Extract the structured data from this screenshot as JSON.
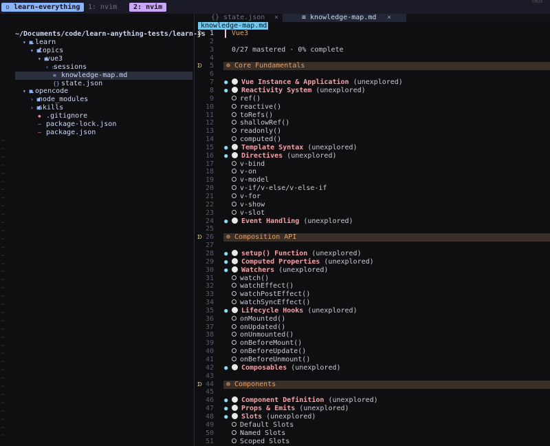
{
  "tmux": {
    "session": "learn-everything",
    "win1": "1: nvim",
    "win2": "2: nvim",
    "top_right": "tmux"
  },
  "explorer": {
    "root": "~/Documents/code/learn-anything-tests/learn-js",
    "items": [
      {
        "icon": "▾ ■",
        "label": ".learn",
        "color": "#cdd6f4",
        "indent": 1
      },
      {
        "icon": "▾ ■",
        "label": "topics",
        "color": "#cdd6f4",
        "indent": 2
      },
      {
        "icon": "▾ ■",
        "label": "vue3",
        "color": "#cdd6f4",
        "indent": 3
      },
      {
        "icon": "› ▫",
        "label": "sessions",
        "color": "#cdd6f4",
        "indent": 4
      },
      {
        "icon": "≡",
        "label": "knowledge-map.md",
        "color": "#cdd6f4",
        "indent": 5,
        "selected": true
      },
      {
        "icon": "{}",
        "label": "state.json",
        "color": "#cdd6f4",
        "indent": 5
      },
      {
        "icon": "▾ ■",
        "label": ".opencode",
        "color": "#cdd6f4",
        "indent": 1
      },
      {
        "icon": "› ■",
        "label": "node_modules",
        "color": "#cdd6f4",
        "indent": 2
      },
      {
        "icon": "› ■",
        "label": "skills",
        "color": "#cdd6f4",
        "indent": 2
      },
      {
        "icon": "◆",
        "label": ".gitignore",
        "color": "#cdd6f4",
        "indent": 3,
        "icon_color": "#f38ba8"
      },
      {
        "icon": "—",
        "label": "package-lock.json",
        "color": "#cdd6f4",
        "indent": 3
      },
      {
        "icon": "—",
        "label": "package.json",
        "color": "#cdd6f4",
        "indent": 3,
        "icon_color": "#f38ba8"
      }
    ],
    "tilde": "~"
  },
  "tabs": {
    "state": "{} state.json",
    "state_close": "×",
    "km": "≡ knowledge-map.md",
    "km_close": "×",
    "winbar": "knowledge-map.md"
  },
  "lines": [
    {
      "n": "1",
      "fold": "ᗤ",
      "cur": true,
      "parts": [
        {
          "t": "Vue3",
          "c": "sect"
        }
      ],
      "hl": false
    },
    {
      "n": "2",
      "parts": []
    },
    {
      "n": "3",
      "parts": [
        {
          "t": "0/27 mastered · 0% complete",
          "c": "dim"
        }
      ]
    },
    {
      "n": "4",
      "parts": []
    },
    {
      "n": "5",
      "fold": "ᗤ",
      "hl": true,
      "parts": [
        {
          "t": "⊕ Core Fundamentals",
          "c": "sect"
        }
      ]
    },
    {
      "n": "6",
      "parts": []
    },
    {
      "n": "7",
      "dot": true,
      "circle": true,
      "parts": [
        {
          "t": "Vue Instance & Application",
          "c": "topic"
        },
        {
          "t": " (unexplored)",
          "c": "dim"
        }
      ]
    },
    {
      "n": "8",
      "dot": true,
      "circle": true,
      "parts": [
        {
          "t": "Reactivity System",
          "c": "topic"
        },
        {
          "t": " (unexplored)",
          "c": "dim"
        }
      ]
    },
    {
      "n": "9",
      "hollow": true,
      "parts": [
        {
          "t": "ref()",
          "c": "dim"
        }
      ]
    },
    {
      "n": "10",
      "hollow": true,
      "parts": [
        {
          "t": "reactive()",
          "c": "dim"
        }
      ]
    },
    {
      "n": "11",
      "hollow": true,
      "parts": [
        {
          "t": "toRefs()",
          "c": "dim"
        }
      ]
    },
    {
      "n": "12",
      "hollow": true,
      "parts": [
        {
          "t": "shallowRef()",
          "c": "dim"
        }
      ]
    },
    {
      "n": "13",
      "hollow": true,
      "parts": [
        {
          "t": "readonly()",
          "c": "dim"
        }
      ]
    },
    {
      "n": "14",
      "hollow": true,
      "parts": [
        {
          "t": "computed()",
          "c": "dim"
        }
      ]
    },
    {
      "n": "15",
      "dot": true,
      "circle": true,
      "parts": [
        {
          "t": "Template Syntax",
          "c": "topic"
        },
        {
          "t": " (unexplored)",
          "c": "dim"
        }
      ]
    },
    {
      "n": "16",
      "dot": true,
      "circle": true,
      "parts": [
        {
          "t": "Directives",
          "c": "topic"
        },
        {
          "t": " (unexplored)",
          "c": "dim"
        }
      ]
    },
    {
      "n": "17",
      "hollow": true,
      "parts": [
        {
          "t": "v-bind",
          "c": "dim"
        }
      ]
    },
    {
      "n": "18",
      "hollow": true,
      "parts": [
        {
          "t": "v-on",
          "c": "dim"
        }
      ]
    },
    {
      "n": "19",
      "hollow": true,
      "parts": [
        {
          "t": "v-model",
          "c": "dim"
        }
      ]
    },
    {
      "n": "20",
      "hollow": true,
      "parts": [
        {
          "t": "v-if/v-else/v-else-if",
          "c": "dim"
        }
      ]
    },
    {
      "n": "21",
      "hollow": true,
      "parts": [
        {
          "t": "v-for",
          "c": "dim"
        }
      ]
    },
    {
      "n": "22",
      "hollow": true,
      "parts": [
        {
          "t": "v-show",
          "c": "dim"
        }
      ]
    },
    {
      "n": "23",
      "hollow": true,
      "parts": [
        {
          "t": "v-slot",
          "c": "dim"
        }
      ]
    },
    {
      "n": "24",
      "dot": true,
      "circle": true,
      "parts": [
        {
          "t": "Event Handling",
          "c": "topic"
        },
        {
          "t": " (unexplored)",
          "c": "dim"
        }
      ]
    },
    {
      "n": "25",
      "parts": []
    },
    {
      "n": "26",
      "fold": "ᗤ",
      "hl": true,
      "parts": [
        {
          "t": "⊕ Composition API",
          "c": "sect"
        }
      ]
    },
    {
      "n": "27",
      "parts": []
    },
    {
      "n": "28",
      "dot": true,
      "circle": true,
      "parts": [
        {
          "t": "setup() Function",
          "c": "topic"
        },
        {
          "t": " (unexplored)",
          "c": "dim"
        }
      ]
    },
    {
      "n": "29",
      "dot": true,
      "circle": true,
      "parts": [
        {
          "t": "Computed Properties",
          "c": "topic"
        },
        {
          "t": " (unexplored)",
          "c": "dim"
        }
      ]
    },
    {
      "n": "30",
      "dot": true,
      "circle": true,
      "parts": [
        {
          "t": "Watchers",
          "c": "topic"
        },
        {
          "t": " (unexplored)",
          "c": "dim"
        }
      ]
    },
    {
      "n": "31",
      "hollow": true,
      "parts": [
        {
          "t": "watch()",
          "c": "dim"
        }
      ]
    },
    {
      "n": "32",
      "hollow": true,
      "parts": [
        {
          "t": "watchEffect()",
          "c": "dim"
        }
      ]
    },
    {
      "n": "33",
      "hollow": true,
      "parts": [
        {
          "t": "watchPostEffect()",
          "c": "dim"
        }
      ]
    },
    {
      "n": "34",
      "hollow": true,
      "parts": [
        {
          "t": "watchSyncEffect()",
          "c": "dim"
        }
      ]
    },
    {
      "n": "35",
      "dot": true,
      "circle": true,
      "parts": [
        {
          "t": "Lifecycle Hooks",
          "c": "topic"
        },
        {
          "t": " (unexplored)",
          "c": "dim"
        }
      ]
    },
    {
      "n": "36",
      "hollow": true,
      "parts": [
        {
          "t": "onMounted()",
          "c": "dim"
        }
      ]
    },
    {
      "n": "37",
      "hollow": true,
      "parts": [
        {
          "t": "onUpdated()",
          "c": "dim"
        }
      ]
    },
    {
      "n": "38",
      "hollow": true,
      "parts": [
        {
          "t": "onUnmounted()",
          "c": "dim"
        }
      ]
    },
    {
      "n": "39",
      "hollow": true,
      "parts": [
        {
          "t": "onBeforeMount()",
          "c": "dim"
        }
      ]
    },
    {
      "n": "40",
      "hollow": true,
      "parts": [
        {
          "t": "onBeforeUpdate()",
          "c": "dim"
        }
      ]
    },
    {
      "n": "41",
      "hollow": true,
      "parts": [
        {
          "t": "onBeforeUnmount()",
          "c": "dim"
        }
      ]
    },
    {
      "n": "42",
      "dot": true,
      "circle": true,
      "parts": [
        {
          "t": "Composables",
          "c": "topic"
        },
        {
          "t": " (unexplored)",
          "c": "dim"
        }
      ]
    },
    {
      "n": "43",
      "parts": []
    },
    {
      "n": "44",
      "fold": "ᗤ",
      "hl": true,
      "parts": [
        {
          "t": "⊕ Components",
          "c": "sect"
        }
      ]
    },
    {
      "n": "45",
      "parts": []
    },
    {
      "n": "46",
      "dot": true,
      "circle": true,
      "parts": [
        {
          "t": "Component Definition",
          "c": "topic"
        },
        {
          "t": " (unexplored)",
          "c": "dim"
        }
      ]
    },
    {
      "n": "47",
      "dot": true,
      "circle": true,
      "parts": [
        {
          "t": "Props & Emits",
          "c": "topic"
        },
        {
          "t": " (unexplored)",
          "c": "dim"
        }
      ]
    },
    {
      "n": "48",
      "dot": true,
      "circle": true,
      "parts": [
        {
          "t": "Slots",
          "c": "topic"
        },
        {
          "t": " (unexplored)",
          "c": "dim"
        }
      ]
    },
    {
      "n": "49",
      "hollow": true,
      "parts": [
        {
          "t": "Default Slots",
          "c": "dim"
        }
      ]
    },
    {
      "n": "50",
      "hollow": true,
      "parts": [
        {
          "t": "Named Slots",
          "c": "dim"
        }
      ]
    },
    {
      "n": "51",
      "hollow": true,
      "parts": [
        {
          "t": "Scoped Slots",
          "c": "dim"
        }
      ]
    }
  ],
  "colors": {
    "accent": "#89b4fa",
    "topic": "#f5a0a6",
    "section": "#e0a36c",
    "winbar": "#74c7ec"
  }
}
